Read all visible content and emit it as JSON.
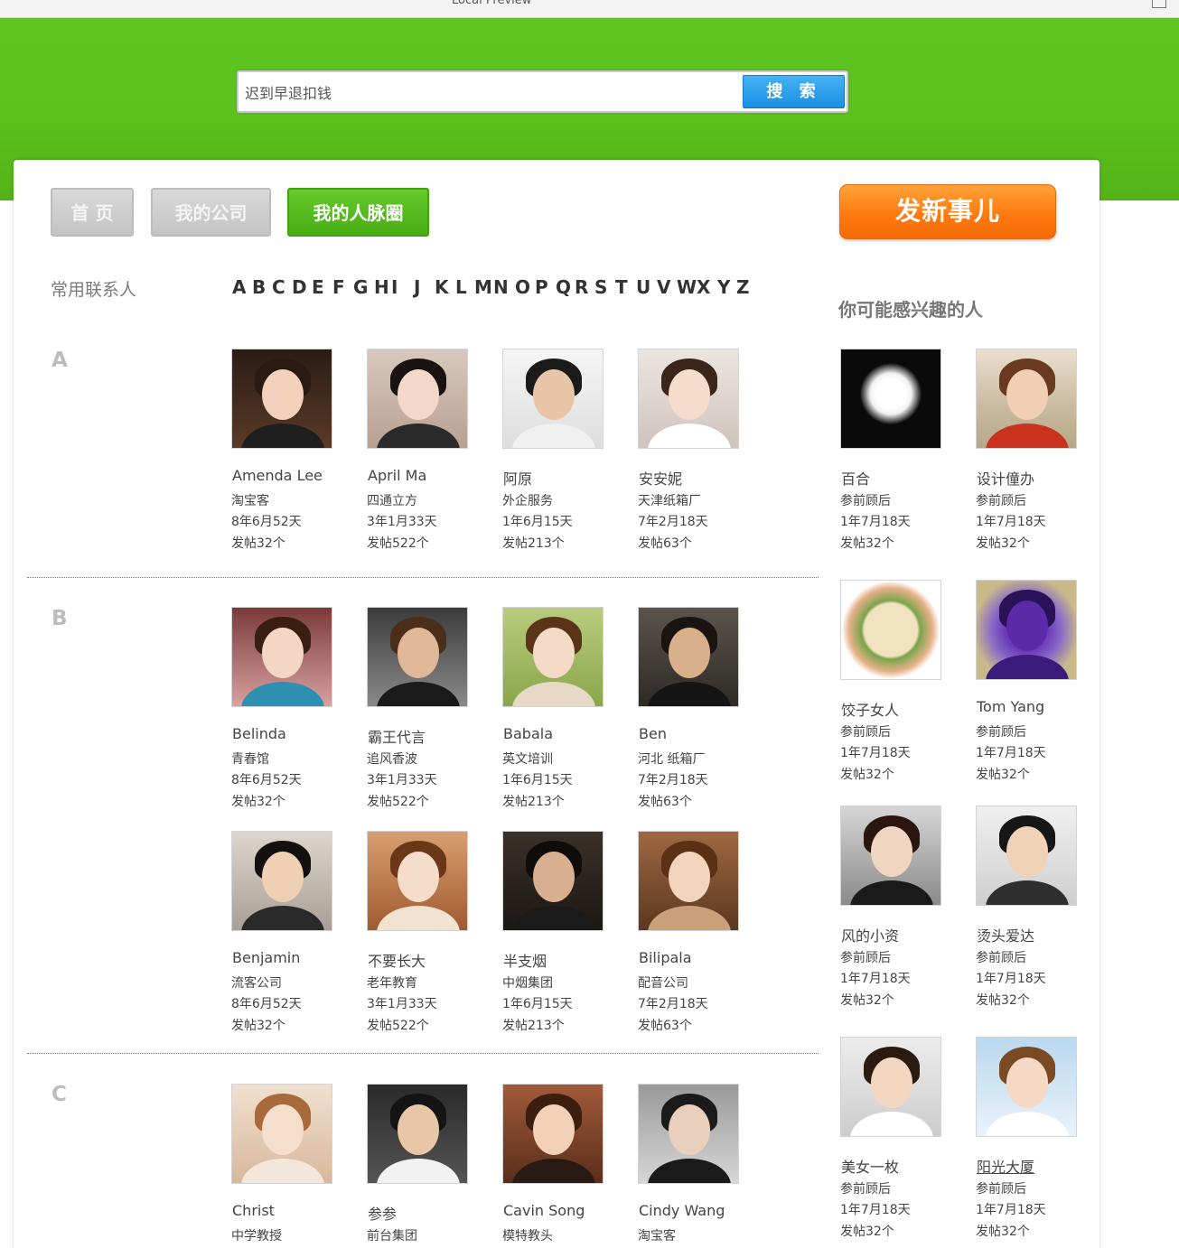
{
  "window": {
    "title": "Local Preview"
  },
  "search": {
    "value": "迟到早退扣钱",
    "button_label": "搜 索"
  },
  "nav": {
    "home": "首 页",
    "company": "我的公司",
    "network": "我的人脉圈"
  },
  "post_button": "发新事儿",
  "contacts_title": "常用联系人",
  "alphabet": [
    "A",
    "B",
    "C",
    "D",
    "E",
    "F",
    "G",
    "H",
    "I",
    "J",
    "K",
    "L",
    "M",
    "N",
    "O",
    "P",
    "Q",
    "R",
    "S",
    "T",
    "U",
    "V",
    "W",
    "X",
    "Y",
    "Z"
  ],
  "groups": [
    {
      "letter": "A",
      "people": [
        {
          "name": "Amenda Lee",
          "company": "淘宝客",
          "duration": "8年6月52天",
          "posts": "发帖32个",
          "look": "f1"
        },
        {
          "name": "April Ma",
          "company": "四通立方",
          "duration": "3年1月33天",
          "posts": "发帖522个",
          "look": "f2"
        },
        {
          "name": "阿原",
          "company": "外企服务",
          "duration": "1年6月15天",
          "posts": "发帖213个",
          "look": "m1"
        },
        {
          "name": "安安妮",
          "company": "天津纸箱厂",
          "duration": "7年2月18天",
          "posts": "发帖63个",
          "look": "f3"
        }
      ]
    },
    {
      "letter": "B",
      "people": [
        {
          "name": "Belinda",
          "company": "青春馆",
          "duration": "8年6月52天",
          "posts": "发帖32个",
          "look": "f4"
        },
        {
          "name": "霸王代言",
          "company": "追风香波",
          "duration": "3年1月33天",
          "posts": "发帖522个",
          "look": "m2"
        },
        {
          "name": "Babala",
          "company": "英文培训",
          "duration": "1年6月15天",
          "posts": "发帖213个",
          "look": "f5"
        },
        {
          "name": "Ben",
          "company": "河北 纸箱厂",
          "duration": "7年2月18天",
          "posts": "发帖63个",
          "look": "m3"
        },
        {
          "name": "Benjamin",
          "company": "流客公司",
          "duration": "8年6月52天",
          "posts": "发帖32个",
          "look": "m4"
        },
        {
          "name": "不要长大",
          "company": "老年教育",
          "duration": "3年1月33天",
          "posts": "发帖522个",
          "look": "f6"
        },
        {
          "name": "半支烟",
          "company": "中烟集团",
          "duration": "1年6月15天",
          "posts": "发帖213个",
          "look": "m5"
        },
        {
          "name": "Bilipala",
          "company": "配音公司",
          "duration": "7年2月18天",
          "posts": "发帖63个",
          "look": "f7"
        }
      ]
    },
    {
      "letter": "C",
      "people": [
        {
          "name": "Christ",
          "company": "中学教授",
          "duration": "",
          "posts": "",
          "look": "f8"
        },
        {
          "name": "参参",
          "company": "前台集团",
          "duration": "",
          "posts": "",
          "look": "m6"
        },
        {
          "name": "Cavin Song",
          "company": "模特教头",
          "duration": "",
          "posts": "",
          "look": "f9"
        },
        {
          "name": "Cindy Wang",
          "company": "淘宝客",
          "duration": "",
          "posts": "",
          "look": "m7"
        }
      ]
    }
  ],
  "recommend": {
    "title": "你可能感兴趣的人",
    "people": [
      {
        "name": "百合",
        "role": "参前顾后",
        "duration": "1年7月18天",
        "posts": "发帖32个",
        "look": "lily"
      },
      {
        "name": "设计僮办",
        "role": "参前顾后",
        "duration": "1年7月18天",
        "posts": "发帖32个",
        "look": "painting"
      },
      {
        "name": "饺子女人",
        "role": "参前顾后",
        "duration": "1年7月18天",
        "posts": "发帖32个",
        "look": "dumpling"
      },
      {
        "name": "Tom Yang",
        "role": "参前顾后",
        "duration": "1年7月18天",
        "posts": "发帖32个",
        "look": "purple"
      },
      {
        "name": "风的小资",
        "role": "参前顾后",
        "duration": "1年7月18天",
        "posts": "发帖32个",
        "look": "m8"
      },
      {
        "name": "烫头爱达",
        "role": "参前顾后",
        "duration": "1年7月18天",
        "posts": "发帖32个",
        "look": "m9"
      },
      {
        "name": "美女一枚",
        "role": "参前顾后",
        "duration": "1年7月18天",
        "posts": "发帖32个",
        "look": "f10"
      },
      {
        "name": "阳光大厦",
        "role": "参前顾后",
        "duration": "1年7月18天",
        "posts": "发帖32个",
        "look": "f11"
      }
    ]
  }
}
